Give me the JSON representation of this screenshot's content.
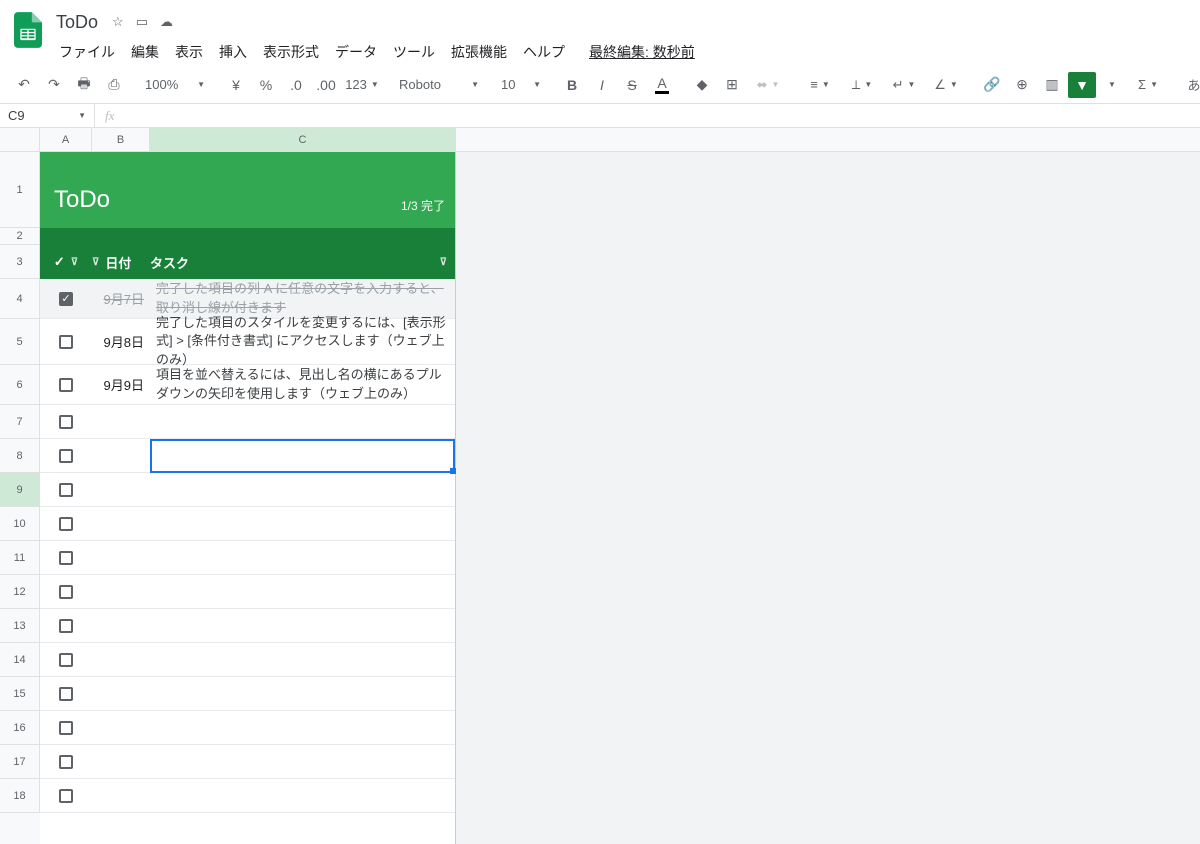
{
  "doc": {
    "title": "ToDo"
  },
  "menu": {
    "file": "ファイル",
    "edit": "編集",
    "view": "表示",
    "insert": "挿入",
    "format": "表示形式",
    "data": "データ",
    "tools": "ツール",
    "ext": "拡張機能",
    "help": "ヘルプ",
    "last_edit": "最終編集: 数秒前"
  },
  "toolbar": {
    "zoom": "100%",
    "yen": "¥",
    "pct": "%",
    "more_fmt": "123",
    "font": "Roboto",
    "size": "10",
    "japanese": "あ"
  },
  "namebox": "C9",
  "cols": {
    "a": "A",
    "b": "B",
    "c": "C",
    "a_w": 52,
    "b_w": 58,
    "c_w": 306
  },
  "sheet": {
    "title": "ToDo",
    "progress": "1/3 完了",
    "hdr_date": "日付",
    "hdr_task": "タスク",
    "check": "✓"
  },
  "rows": [
    {
      "n": "1"
    },
    {
      "n": "2"
    },
    {
      "n": "3"
    },
    {
      "n": "4",
      "checked": true,
      "date": "9月7日",
      "task": "完了した項目の列 A に任意の文字を入力すると、取り消し線が付きます"
    },
    {
      "n": "5",
      "checked": false,
      "date": "9月8日",
      "task": "完了した項目のスタイルを変更するには、[表示形式] > [条件付き書式] にアクセスします（ウェブ上のみ）"
    },
    {
      "n": "6",
      "checked": false,
      "date": "9月9日",
      "task": "項目を並べ替えるには、見出し名の横にあるプルダウンの矢印を使用します（ウェブ上のみ）"
    },
    {
      "n": "7"
    },
    {
      "n": "8"
    },
    {
      "n": "9"
    },
    {
      "n": "10"
    },
    {
      "n": "11"
    },
    {
      "n": "12"
    },
    {
      "n": "13"
    },
    {
      "n": "14"
    },
    {
      "n": "15"
    },
    {
      "n": "16"
    },
    {
      "n": "17"
    },
    {
      "n": "18"
    }
  ]
}
